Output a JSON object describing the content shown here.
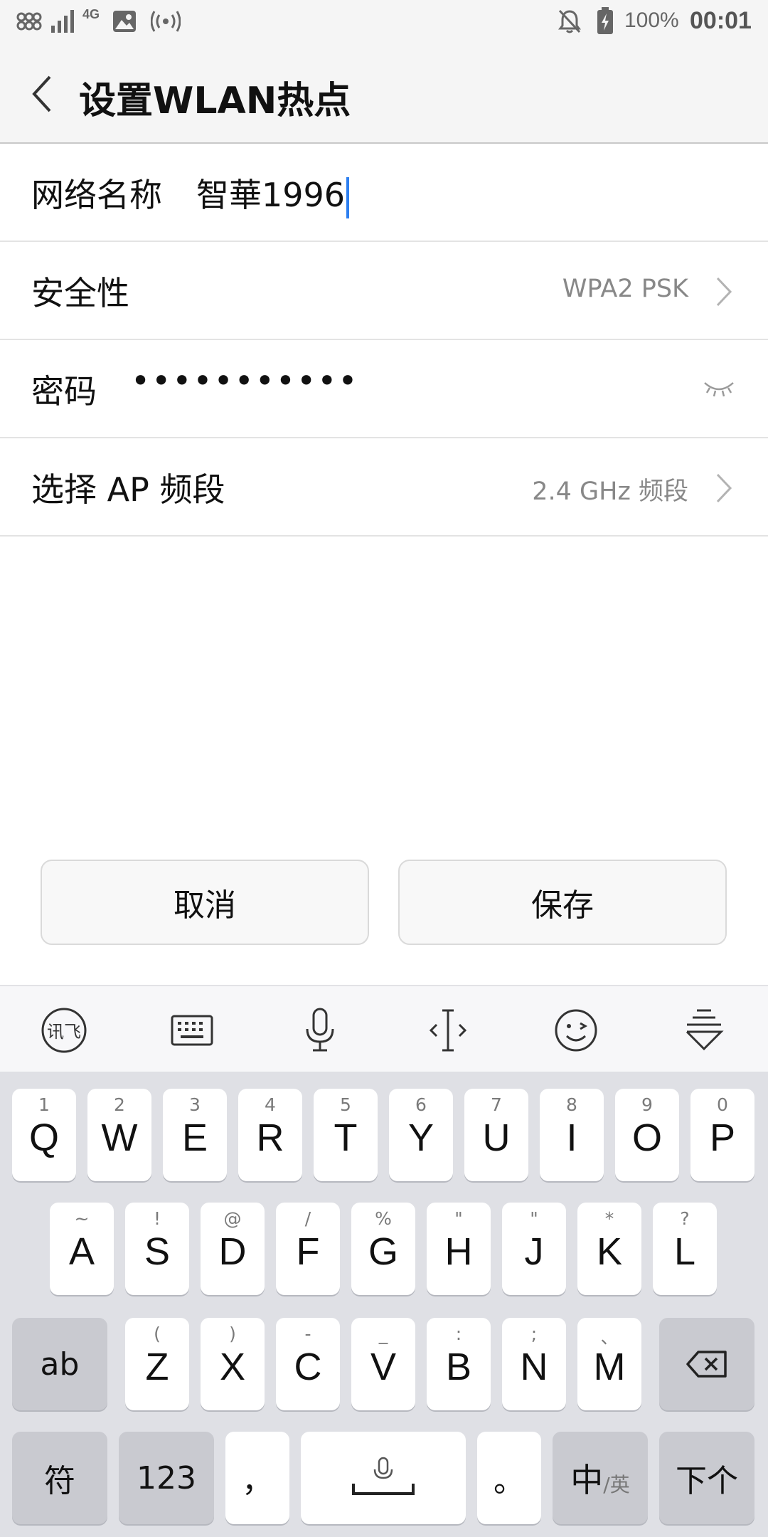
{
  "status_bar": {
    "network": "4G",
    "battery": "100%",
    "time": "00:01"
  },
  "header": {
    "title": "设置WLAN热点"
  },
  "form": {
    "network_name_label": "网络名称",
    "network_name_value": "智華1996",
    "security_label": "安全性",
    "security_value": "WPA2 PSK",
    "password_label": "密码",
    "password_value": "•••••••••••",
    "band_label": "选择 AP 频段",
    "band_value": "2.4 GHz 频段"
  },
  "actions": {
    "cancel_label": "取消",
    "save_label": "保存"
  },
  "keyboard": {
    "toolbar_icons": [
      "ifly-logo-icon",
      "keyboard-icon",
      "microphone-icon",
      "cursor-move-icon",
      "emoji-icon",
      "hide-keyboard-icon"
    ],
    "row1": [
      {
        "hint": "1",
        "key": "Q"
      },
      {
        "hint": "2",
        "key": "W"
      },
      {
        "hint": "3",
        "key": "E"
      },
      {
        "hint": "4",
        "key": "R"
      },
      {
        "hint": "5",
        "key": "T"
      },
      {
        "hint": "6",
        "key": "Y"
      },
      {
        "hint": "7",
        "key": "U"
      },
      {
        "hint": "8",
        "key": "I"
      },
      {
        "hint": "9",
        "key": "O"
      },
      {
        "hint": "0",
        "key": "P"
      }
    ],
    "row2": [
      {
        "hint": "~",
        "key": "A"
      },
      {
        "hint": "!",
        "key": "S"
      },
      {
        "hint": "@",
        "key": "D"
      },
      {
        "hint": "/",
        "key": "F"
      },
      {
        "hint": "%",
        "key": "G"
      },
      {
        "hint": "\"",
        "key": "H"
      },
      {
        "hint": "\"",
        "key": "J"
      },
      {
        "hint": "*",
        "key": "K"
      },
      {
        "hint": "?",
        "key": "L"
      }
    ],
    "row3": [
      {
        "hint": "(",
        "key": "Z"
      },
      {
        "hint": ")",
        "key": "X"
      },
      {
        "hint": "-",
        "key": "C"
      },
      {
        "hint": "_",
        "key": "V"
      },
      {
        "hint": ":",
        "key": "B"
      },
      {
        "hint": ";",
        "key": "N"
      },
      {
        "hint": "、",
        "key": "M"
      }
    ],
    "shift_label": "ab",
    "symbols_label": "符",
    "numbers_label": "123",
    "comma_label": "，",
    "period_label": "。",
    "lang_main": "中",
    "lang_sub": "/英",
    "next_label": "下个"
  }
}
